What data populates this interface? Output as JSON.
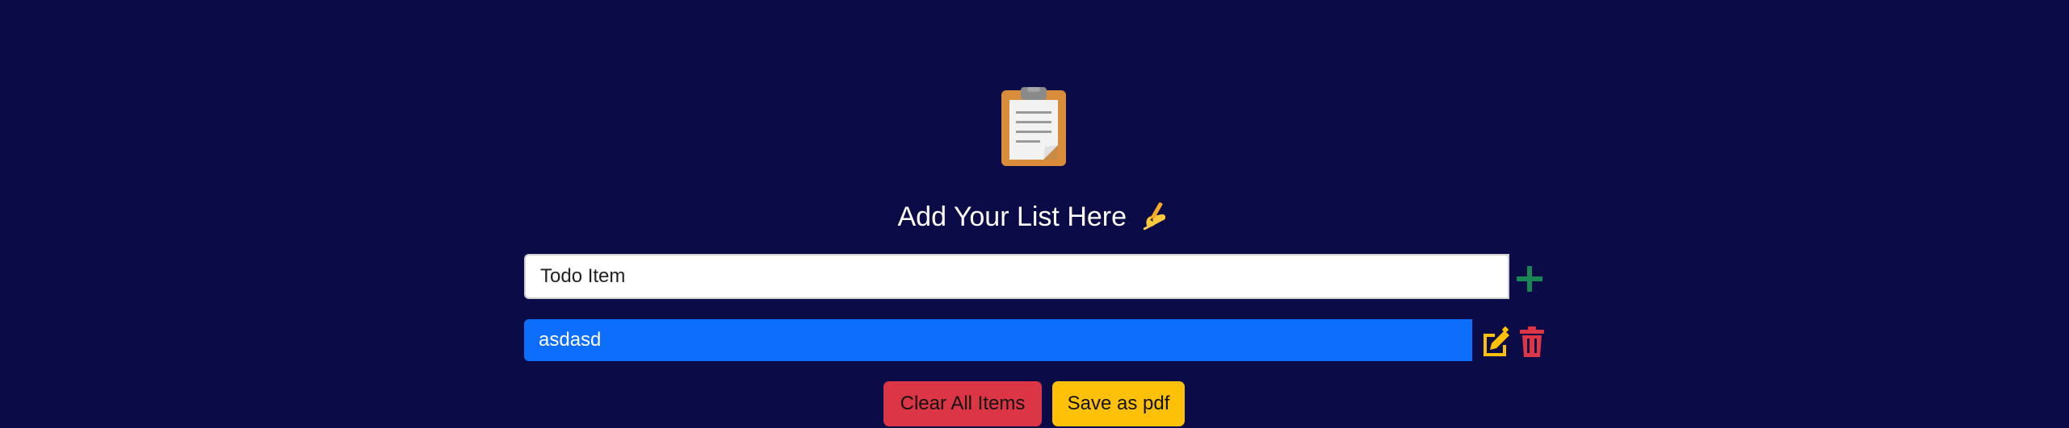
{
  "header": {
    "logo_icon": "clipboard-icon",
    "title": "Add Your List Here",
    "title_emoji_icon": "writing-hand-icon"
  },
  "input": {
    "placeholder": "Todo Item",
    "value": "",
    "add_icon": "plus-icon"
  },
  "items": [
    {
      "text": "asdasd",
      "edit_icon": "edit-icon",
      "delete_icon": "trash-icon"
    }
  ],
  "actions": {
    "clear_label": "Clear All Items",
    "save_label": "Save as pdf"
  },
  "colors": {
    "background": "#0b0b48",
    "item_bg": "#0d6efd",
    "add": "#198754",
    "edit": "#ffc107",
    "delete": "#dc3545",
    "clear_button": "#dc3545",
    "save_button": "#ffc107"
  }
}
